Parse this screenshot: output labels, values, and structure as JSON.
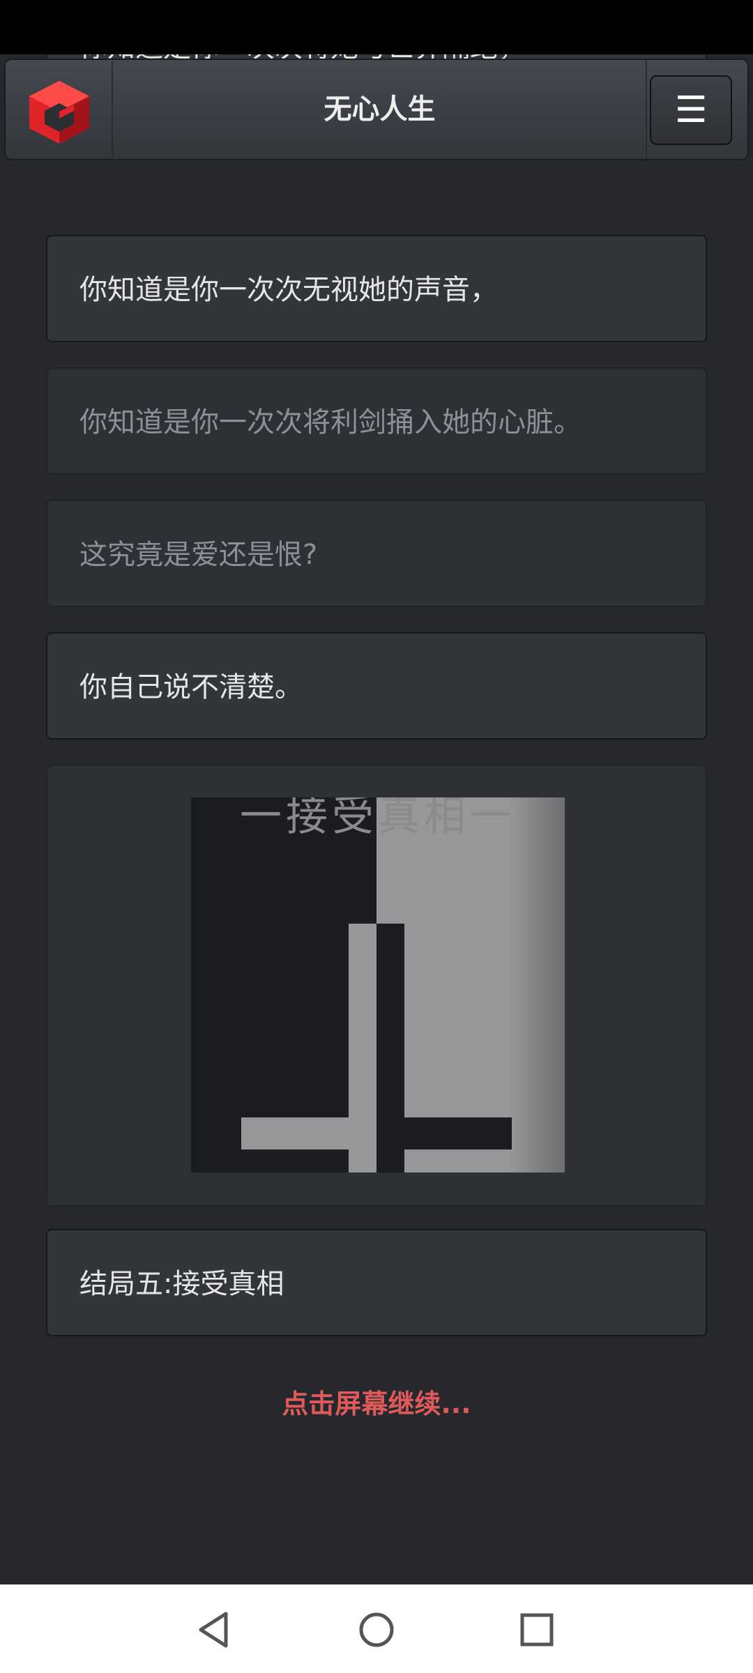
{
  "app": {
    "title": "无心人生",
    "logo_icon": "cube-logo-icon",
    "menu_icon": "☰"
  },
  "story": {
    "partial_line": "你知道是你一次次将她与世界隔绝，",
    "lines": [
      {
        "text": "你知道是你一次次无视她的声音，",
        "dimmed": false
      },
      {
        "text": "你知道是你一次次将利剑捅入她的心脏。",
        "dimmed": true
      },
      {
        "text": "这究竟是爱还是恨?",
        "dimmed": true
      },
      {
        "text": "你自己说不清楚。",
        "dimmed": false
      }
    ],
    "image_caption": "一接受真相一",
    "ending_label": "结局五:接受真相",
    "continue_prompt": "点击屏幕继续..."
  },
  "nav": {
    "back_icon": "back-triangle-icon",
    "home_icon": "home-circle-icon",
    "recents_icon": "recents-square-icon"
  },
  "colors": {
    "background": "#26282d",
    "card": "#32353a",
    "continue": "#e05a5a",
    "logo_red": "#e0242a"
  }
}
